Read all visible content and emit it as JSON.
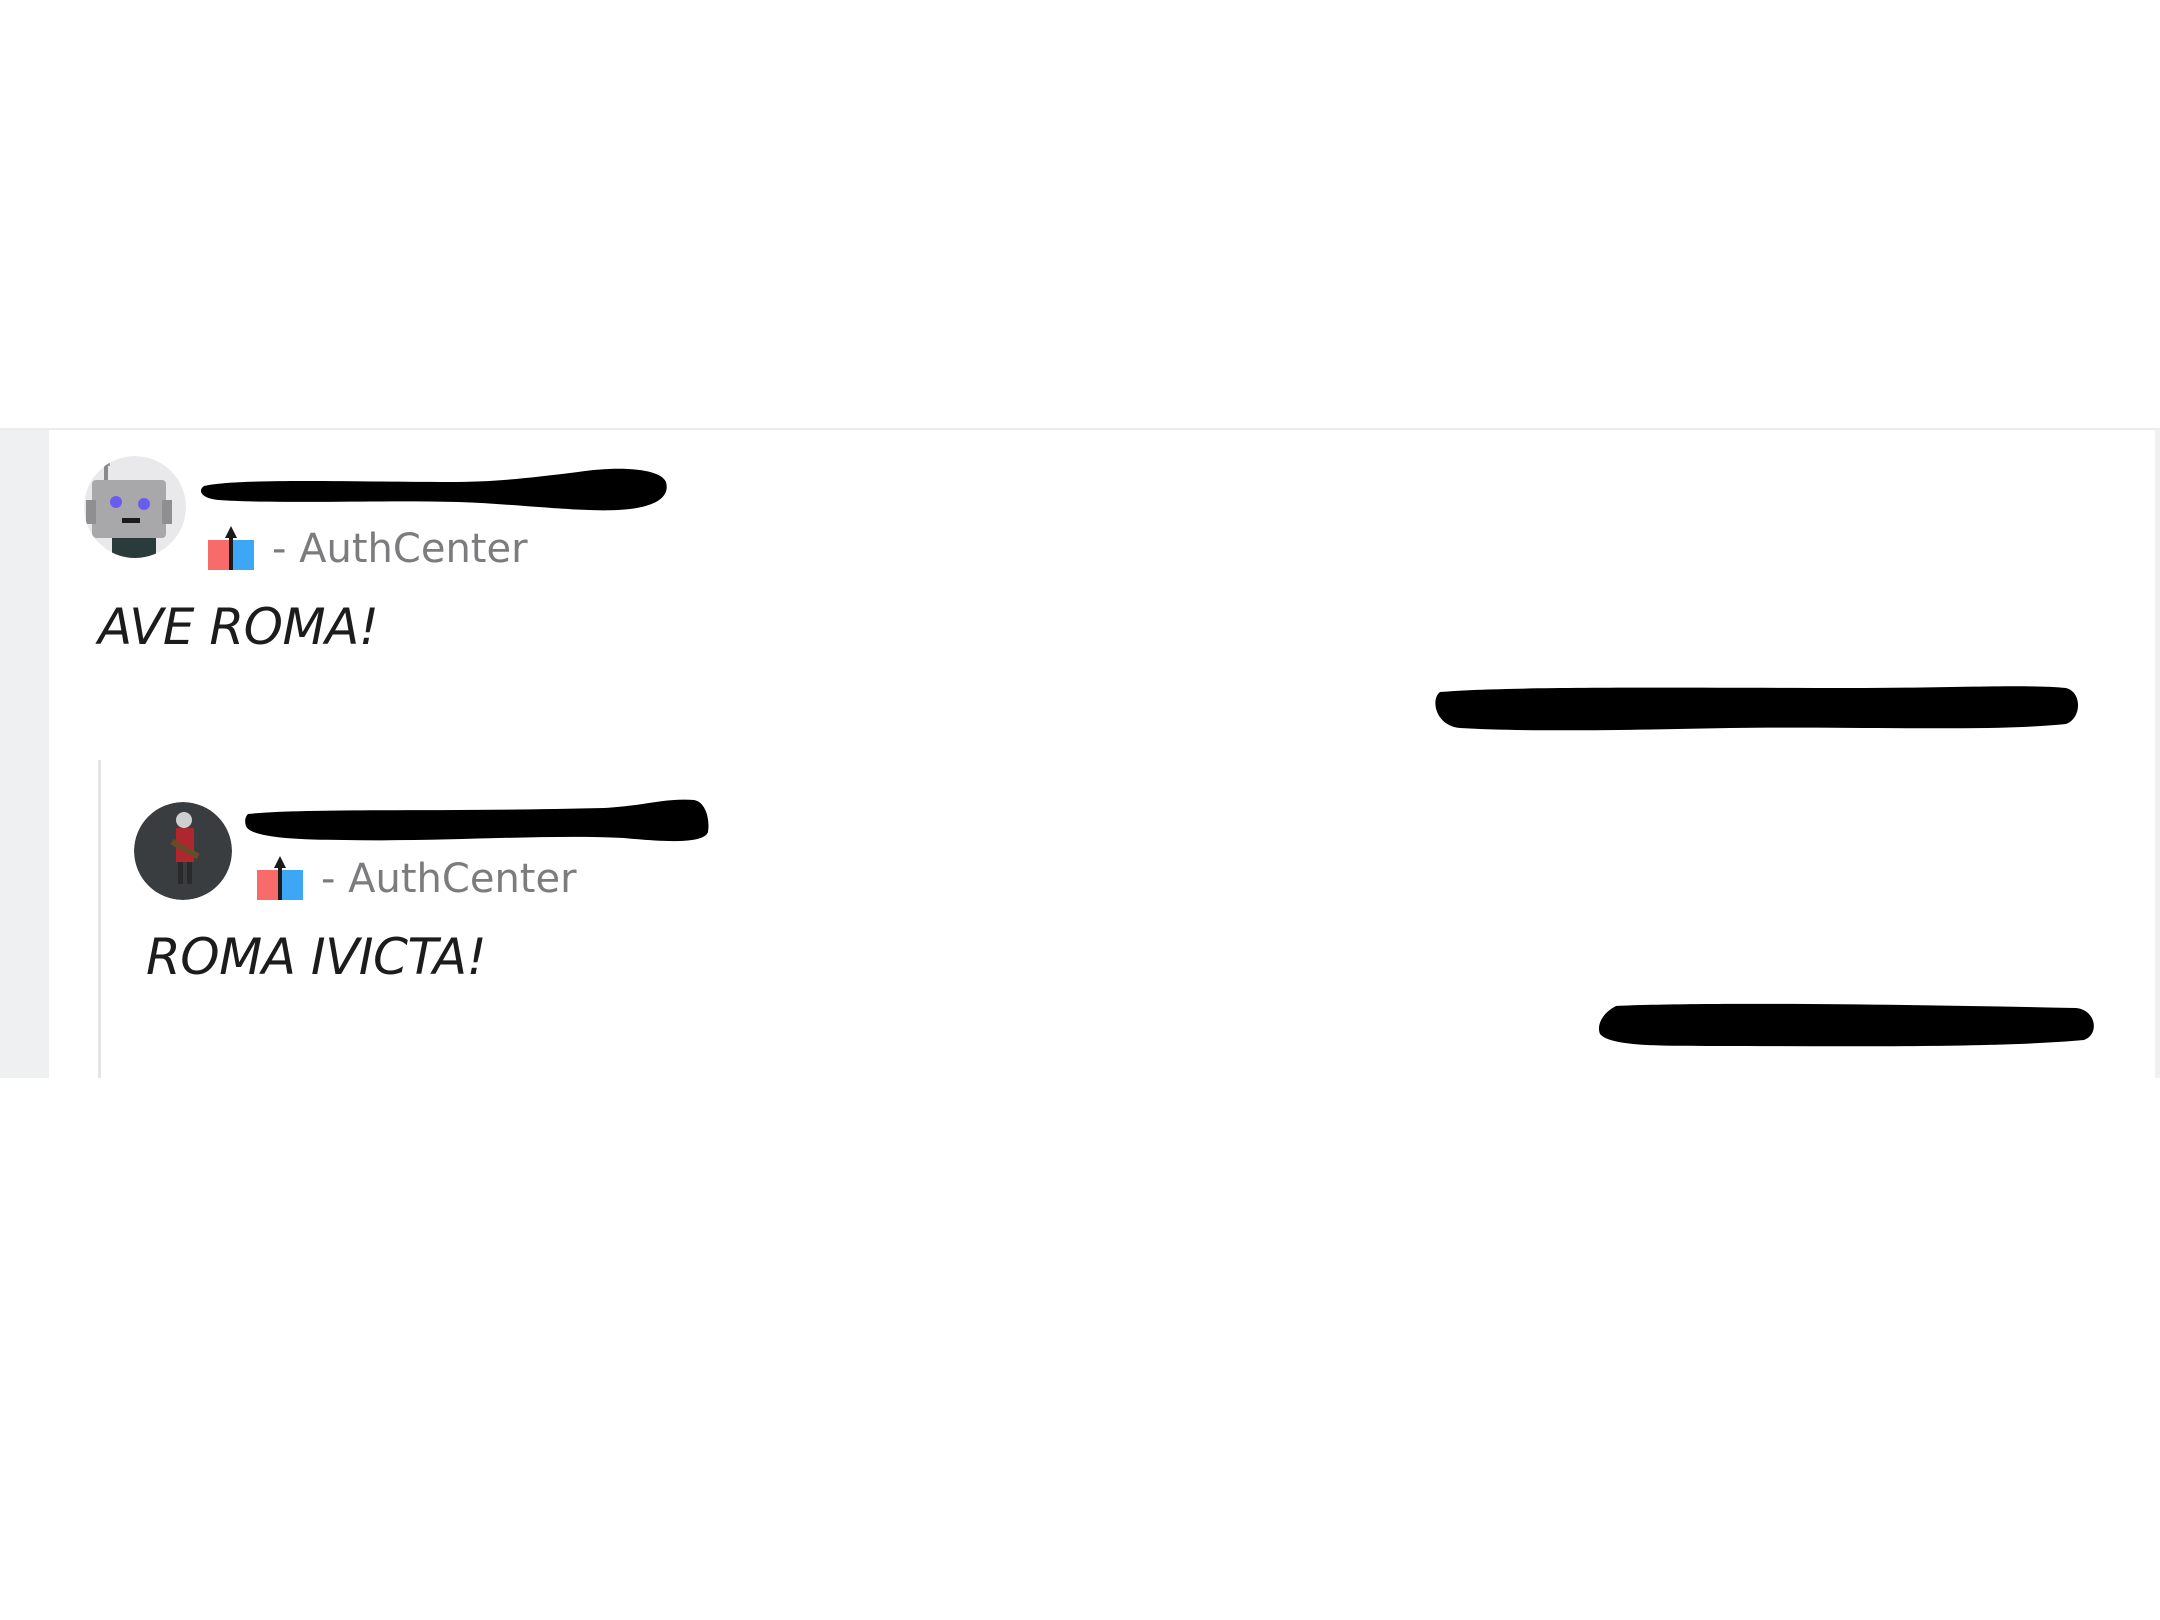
{
  "comments": [
    {
      "username": "",
      "avatar": "snoo-robot-avatar",
      "flair_icon": "red-blue-center-flair",
      "flair": "- AuthCenter",
      "body": "AVE ROMA!",
      "meta": ""
    },
    {
      "username": "",
      "avatar": "roman-soldier-avatar",
      "flair_icon": "red-blue-center-flair",
      "flair": "- AuthCenter",
      "body": "ROMA IVICTA!",
      "meta": ""
    }
  ],
  "colors": {
    "flair_left": "#f76b6b",
    "flair_right": "#3ea7f5",
    "gutter": "#eff0f2",
    "thread_line": "#e3e4e6",
    "flair_text": "#7c7c7e",
    "body_text": "#1c1c1c"
  }
}
